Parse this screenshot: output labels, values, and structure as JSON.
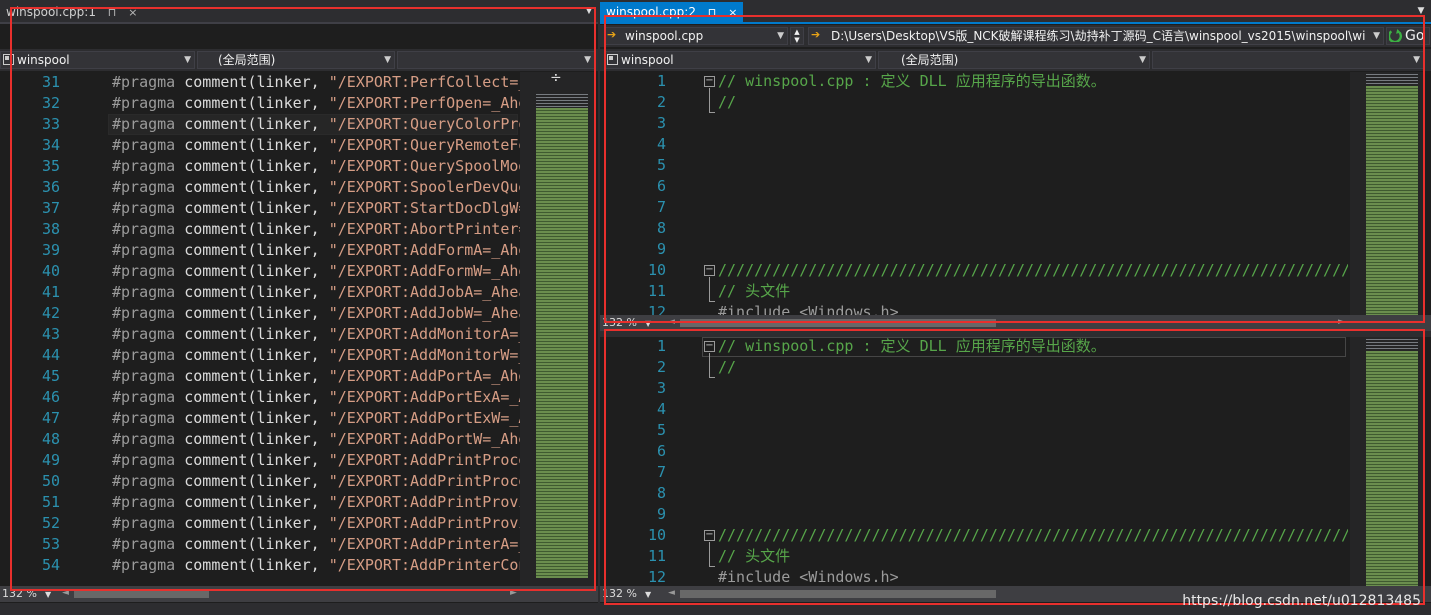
{
  "left_pane": {
    "tab_title": "winspool.cpp:1",
    "pin_glyph": "⊓",
    "close_glyph": "×",
    "nav": {
      "project": "winspool",
      "scope": "(全局范围)",
      "member": ""
    },
    "zoom": "132 %",
    "split_glyph": "÷",
    "lines": [
      {
        "n": "31",
        "pp": "#pragma",
        "fn": "comment(linker,",
        "str": "\"/EXPORT:PerfCollect=_Ah"
      },
      {
        "n": "32",
        "pp": "#pragma",
        "fn": "comment(linker,",
        "str": "\"/EXPORT:PerfOpen=_Ahead"
      },
      {
        "n": "33",
        "pp": "#pragma",
        "fn": "comment(linker,",
        "str": "\"/EXPORT:QueryColorProfi"
      },
      {
        "n": "34",
        "pp": "#pragma",
        "fn": "comment(linker,",
        "str": "\"/EXPORT:QueryRemoteFont"
      },
      {
        "n": "35",
        "pp": "#pragma",
        "fn": "comment(linker,",
        "str": "\"/EXPORT:QuerySpoolMode="
      },
      {
        "n": "36",
        "pp": "#pragma",
        "fn": "comment(linker,",
        "str": "\"/EXPORT:SpoolerDevQuery"
      },
      {
        "n": "37",
        "pp": "#pragma",
        "fn": "comment(linker,",
        "str": "\"/EXPORT:StartDocDlgW=_A"
      },
      {
        "n": "38",
        "pp": "#pragma",
        "fn": "comment(linker,",
        "str": "\"/EXPORT:AbortPrinter=_A"
      },
      {
        "n": "39",
        "pp": "#pragma",
        "fn": "comment(linker,",
        "str": "\"/EXPORT:AddFormA=_Ahead"
      },
      {
        "n": "40",
        "pp": "#pragma",
        "fn": "comment(linker,",
        "str": "\"/EXPORT:AddFormW=_Ahead"
      },
      {
        "n": "41",
        "pp": "#pragma",
        "fn": "comment(linker,",
        "str": "\"/EXPORT:AddJobA=_AheadL"
      },
      {
        "n": "42",
        "pp": "#pragma",
        "fn": "comment(linker,",
        "str": "\"/EXPORT:AddJobW=_AheadL"
      },
      {
        "n": "43",
        "pp": "#pragma",
        "fn": "comment(linker,",
        "str": "\"/EXPORT:AddMonitorA=_Ah"
      },
      {
        "n": "44",
        "pp": "#pragma",
        "fn": "comment(linker,",
        "str": "\"/EXPORT:AddMonitorW=_Ah"
      },
      {
        "n": "45",
        "pp": "#pragma",
        "fn": "comment(linker,",
        "str": "\"/EXPORT:AddPortA=_Ahead"
      },
      {
        "n": "46",
        "pp": "#pragma",
        "fn": "comment(linker,",
        "str": "\"/EXPORT:AddPortExA=_Ahe"
      },
      {
        "n": "47",
        "pp": "#pragma",
        "fn": "comment(linker,",
        "str": "\"/EXPORT:AddPortExW=_Ahe"
      },
      {
        "n": "48",
        "pp": "#pragma",
        "fn": "comment(linker,",
        "str": "\"/EXPORT:AddPortW=_Ahead"
      },
      {
        "n": "49",
        "pp": "#pragma",
        "fn": "comment(linker,",
        "str": "\"/EXPORT:AddPrintProcess"
      },
      {
        "n": "50",
        "pp": "#pragma",
        "fn": "comment(linker,",
        "str": "\"/EXPORT:AddPrintProcess"
      },
      {
        "n": "51",
        "pp": "#pragma",
        "fn": "comment(linker,",
        "str": "\"/EXPORT:AddPrintProvide"
      },
      {
        "n": "52",
        "pp": "#pragma",
        "fn": "comment(linker,",
        "str": "\"/EXPORT:AddPrintProvide"
      },
      {
        "n": "53",
        "pp": "#pragma",
        "fn": "comment(linker,",
        "str": "\"/EXPORT:AddPrinterA=_Ah"
      },
      {
        "n": "54",
        "pp": "#pragma",
        "fn": "comment(linker,",
        "str": "\"/EXPORT:AddPrinterConne"
      }
    ]
  },
  "right_pane": {
    "tab_title": "winspool.cpp:2",
    "pin_glyph": "⊓",
    "close_glyph": "×",
    "file_combo": "winspool.cpp",
    "path": "D:\\Users\\Desktop\\VS版_NCK破解课程练习\\劫持补丁源码_C语言\\winspool_vs2015\\winspool\\wi",
    "go_label": "Go",
    "nav": {
      "project": "winspool",
      "scope": "(全局范围)",
      "member": ""
    },
    "top_zoom": "132 %",
    "bottom_zoom": "132 %",
    "lines": [
      {
        "n": "1",
        "text": "// winspool.cpp : 定义 DLL 应用程序的导出函数。",
        "kind": "cmt"
      },
      {
        "n": "2",
        "text": "//",
        "kind": "cmt"
      },
      {
        "n": "3",
        "text": "",
        "kind": "cmt"
      },
      {
        "n": "4",
        "text": "",
        "kind": "cmt"
      },
      {
        "n": "5",
        "text": "",
        "kind": "cmt"
      },
      {
        "n": "6",
        "text": "",
        "kind": "cmt"
      },
      {
        "n": "7",
        "text": "",
        "kind": "cmt"
      },
      {
        "n": "8",
        "text": "",
        "kind": "cmt"
      },
      {
        "n": "9",
        "text": "",
        "kind": "cmt"
      },
      {
        "n": "10",
        "text": "//////////////////////////////////////////////////////////////////////",
        "kind": "cmt"
      },
      {
        "n": "11",
        "text": "// 头文件",
        "kind": "cmt"
      },
      {
        "n": "12",
        "text": "#include <Windows.h>",
        "kind": "pp"
      }
    ]
  },
  "watermark": "https://blog.csdn.net/u012813485",
  "colors": {
    "editor_bg": "#1e1e1e",
    "chrome_bg": "#2d2d30",
    "active_tab": "#007acc",
    "line_number": "#2b91af",
    "comment": "#57a64a",
    "string": "#d69d85",
    "highlight_box": "#e8302d"
  }
}
